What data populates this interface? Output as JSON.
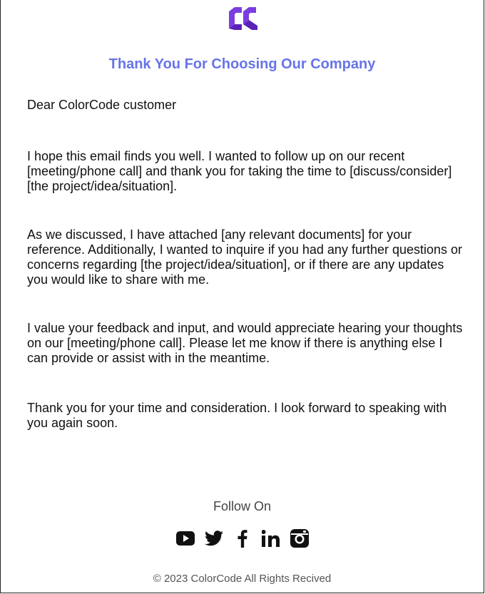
{
  "brand": {
    "logo_icon": "colorcode-logo-icon",
    "logo_color": "#6a2fd2",
    "accent_color": "#6674e8"
  },
  "email": {
    "title": "Thank You For Choosing Our Company",
    "salutation": "Dear ColorCode customer",
    "paragraphs": [
      "I hope this email finds you well. I wanted to follow up on our recent [meeting/phone call] and thank you for taking the time to [discuss/consider] [the project/idea/situation].",
      "As we discussed, I have attached [any relevant documents] for your reference. Additionally, I wanted to inquire if you had any further questions or concerns regarding [the project/idea/situation], or if there are any updates you would like to share with me.",
      "I value your feedback and input, and would appreciate hearing your thoughts on our [meeting/phone call]. Please let me know if there is anything else I can provide or assist with in the meantime.",
      "Thank you for your time and consideration. I look forward to speaking with you again soon."
    ]
  },
  "footer": {
    "follow_label": "Follow On",
    "social": [
      {
        "name": "youtube",
        "icon": "youtube-icon"
      },
      {
        "name": "twitter",
        "icon": "twitter-icon"
      },
      {
        "name": "facebook",
        "icon": "facebook-icon"
      },
      {
        "name": "linkedin",
        "icon": "linkedin-icon"
      },
      {
        "name": "instagram",
        "icon": "instagram-icon"
      }
    ],
    "copyright": "© 2023 ColorCode All Rights Recived"
  }
}
